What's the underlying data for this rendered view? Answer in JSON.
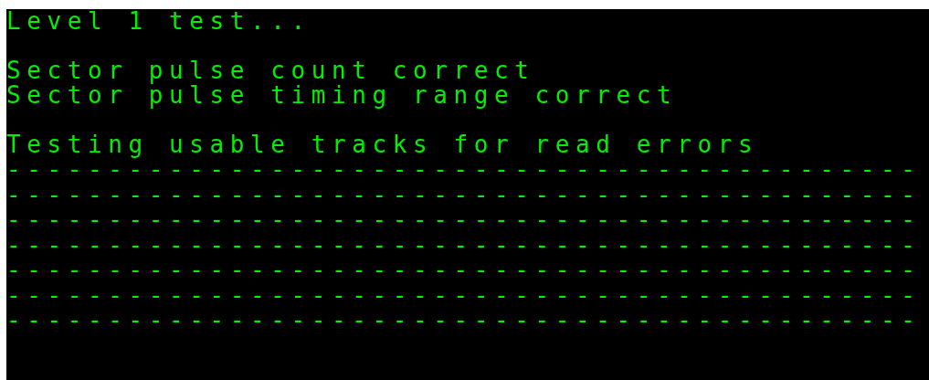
{
  "terminal": {
    "blocks": [
      [
        "Level 1 test..."
      ],
      [
        "Sector pulse count correct",
        "Sector pulse timing range correct"
      ],
      [
        "Testing usable tracks for read errors",
        "---------------------------------------------",
        "---------------------------------------------",
        "---------------------------------------------",
        "---------------------------------------------",
        "---------------------------------------------",
        "---------------------------------------------",
        "---------------------------------------------"
      ]
    ]
  }
}
